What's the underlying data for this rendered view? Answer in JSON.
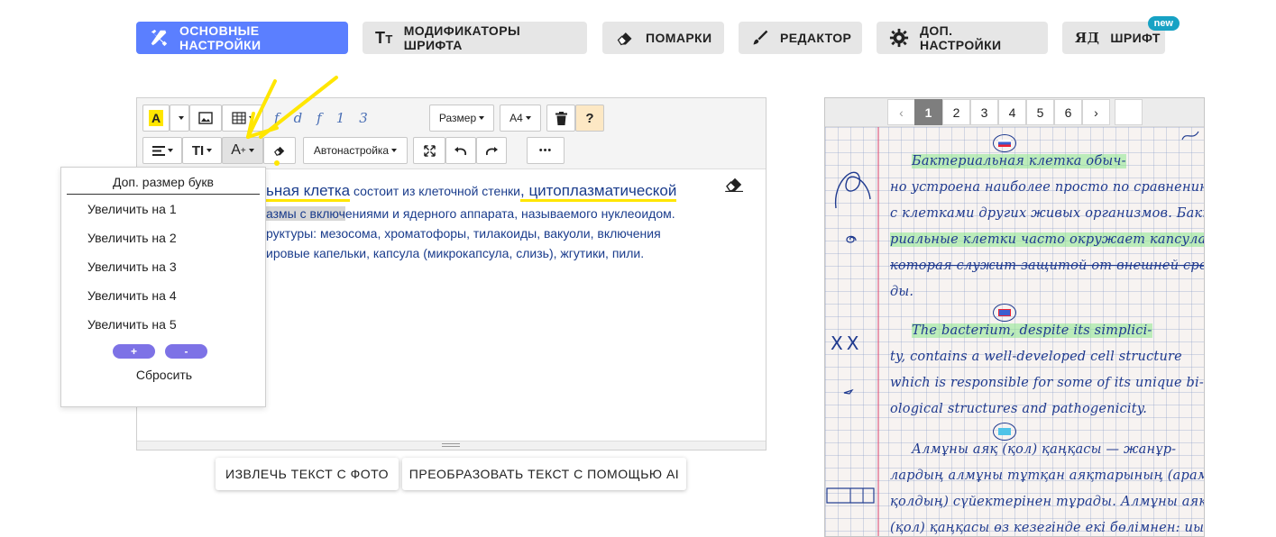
{
  "nav": {
    "main_settings": "ОСНОВНЫЕ НАСТРОЙКИ",
    "font_modifiers": "МОДИФИКАТОРЫ ШРИФТА",
    "blots": "ПОМАРКИ",
    "editor": "РЕДАКТОР",
    "extra_settings": "ДОП. НАСТРОЙКИ",
    "font": "ШРИФТ",
    "font_badge": "new",
    "font_icon_text": "ЯД"
  },
  "toolbar": {
    "font_samples": [
      "f",
      "d",
      "f",
      "1",
      "3"
    ],
    "size_label": "Размер",
    "paper_label": "А4",
    "help_label": "?",
    "textsize_label": "TI",
    "fontsize_label": "A",
    "autoset_label": "Автонастройка",
    "more_label": "•••"
  },
  "content": {
    "line1_a": "ьная клетка",
    "line1_b": " состоит из клеточной стенки",
    "line1_c": ", цитоплазматической",
    "line2_a": "азмы с включ",
    "line2_b": "ениями и ядерного аппарата, называемого нуклеоидом.",
    "line3": "руктуры: мезосома, хроматофоры, тилакоиды, вакуоли, включения",
    "line4": "ировые капельки, капсула (микрокапсула, слизь), жгутики, пили."
  },
  "dropdown": {
    "title": "Доп. размер букв",
    "items": [
      "Увеличить на 1",
      "Увеличить на 2",
      "Увеличить на 3",
      "Увеличить на 4",
      "Увеличить на 5"
    ],
    "plus": "+",
    "minus": "-",
    "reset": "Сбросить"
  },
  "actions": {
    "extract": "ИЗВЛЕЧЬ ТЕКСТ С ФОТО",
    "transform": "ПРЕОБРАЗОВАТЬ ТЕКСТ С ПОМОЩЬЮ AI"
  },
  "pager": {
    "prev": "‹",
    "pages": [
      "1",
      "2",
      "3",
      "4",
      "5",
      "6"
    ],
    "active_page": "1",
    "next": "›"
  },
  "handwriting": [
    "Бактериальная клетка обыч-",
    "но устроена наиболее просто по сравнению",
    "с клетками других живых организмов. Бакте-",
    "риальные клетки часто окружает капсула,",
    "которая служит защитой от внешней сре-",
    "ды.",
    "The bacterium, despite its simplici-",
    "ty, contains a well-developed cell structure",
    "which is responsible for some of its unique bi-",
    "ological structures and pathogenicity.",
    "Алмұны аяқ (қол) қаңқасы — жанұр-",
    "лардың алмұны тұтқан аяқтарының (арамда",
    "қолдың) сүйектерінен тұрады. Алмұны аяқ",
    "(қол) қаңқасы өз кезегінде екі бөлімнен: иық"
  ],
  "margin_marks": "ХХ",
  "colors": {
    "accent": "#5b7fff",
    "badge": "#17a2c4",
    "pill": "#7d72e6",
    "ink": "#1f3a8f",
    "editor_text": "#1a3c8c",
    "yellow_annotation": "#ffe600"
  }
}
